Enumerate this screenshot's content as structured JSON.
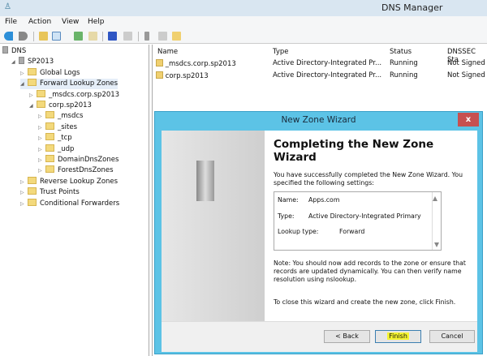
{
  "window": {
    "title": "DNS Manager"
  },
  "menu": [
    "File",
    "Action",
    "View",
    "Help"
  ],
  "toolbar_icons": [
    "back-icon",
    "forward-icon",
    "up-folder-icon",
    "console-tree-icon",
    "refresh-icon",
    "export-icon",
    "help-icon",
    "properties-icon",
    "server-icon",
    "list-icon",
    "zone-icon"
  ],
  "tree": [
    {
      "label": "DNS",
      "level": 0
    },
    {
      "label": "SP2013",
      "level": 1
    },
    {
      "label": "Global Logs",
      "level": 2
    },
    {
      "label": "Forward Lookup Zones",
      "level": 2
    },
    {
      "label": "_msdcs.corp.sp2013",
      "level": 3
    },
    {
      "label": "corp.sp2013",
      "level": 3
    },
    {
      "label": "_msdcs",
      "level": 4
    },
    {
      "label": "_sites",
      "level": 4
    },
    {
      "label": "_tcp",
      "level": 4
    },
    {
      "label": "_udp",
      "level": 4
    },
    {
      "label": "DomainDnsZones",
      "level": 4
    },
    {
      "label": "ForestDnsZones",
      "level": 4
    },
    {
      "label": "Reverse Lookup Zones",
      "level": 2
    },
    {
      "label": "Trust Points",
      "level": 2
    },
    {
      "label": "Conditional Forwarders",
      "level": 2
    }
  ],
  "list": {
    "headers": [
      "Name",
      "Type",
      "Status",
      "DNSSEC Sta"
    ],
    "rows": [
      [
        "_msdcs.corp.sp2013",
        "Active Directory-Integrated Pr...",
        "Running",
        "Not Signed"
      ],
      [
        "corp.sp2013",
        "Active Directory-Integrated Pr...",
        "Running",
        "Not Signed"
      ]
    ]
  },
  "wizard": {
    "title": "New Zone Wizard",
    "close": "x",
    "heading": "Completing the New Zone Wizard",
    "intro": "You have successfully completed the New Zone Wizard. You specified the following settings:",
    "settings": {
      "name_label": "Name:",
      "name_value": "Apps.com",
      "type_label": "Type:",
      "type_value": "Active Directory-Integrated Primary",
      "lookup_label": "Lookup type:",
      "lookup_value": "Forward"
    },
    "note": "Note: You should now add records to the zone or ensure that records are updated dynamically. You can then verify name resolution using nslookup.",
    "closing": "To close this wizard and create the new zone, click Finish.",
    "back": "< Back",
    "finish": "Finish",
    "cancel": "Cancel"
  },
  "colors": {
    "dialog_title": "#5cc3e6",
    "close": "#c75050",
    "highlight": "#f4f430"
  }
}
